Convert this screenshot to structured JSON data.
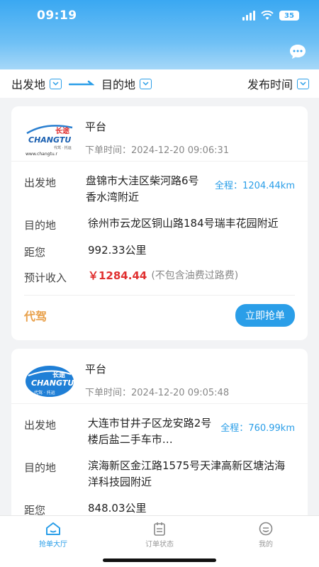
{
  "status": {
    "time": "09:19",
    "battery": "35"
  },
  "filters": {
    "origin": "出发地",
    "destination": "目的地",
    "publish_time": "发布时间"
  },
  "labels": {
    "origin": "出发地",
    "destination": "目的地",
    "distance": "距您",
    "income": "预计收入",
    "income_note": "(不包含油费过路费)",
    "total_prefix": "全程：",
    "order_time_prefix": "下单时间：",
    "grab": "立即抢单"
  },
  "logo": {
    "brand_en": "CHANGTU",
    "brand_cn": "长途",
    "slogan": "代驾 · 托运",
    "url": "www.changtu.r"
  },
  "orders": [
    {
      "platform": "平台",
      "order_time": "2024-12-20 09:06:31",
      "origin": "盘锦市大洼区柴河路6号香水湾附近",
      "total": "1204.44km",
      "destination": "徐州市云龙区铜山路184号瑞丰花园附近",
      "distance": "992.33公里",
      "income": "￥1284.44",
      "tag": "代驾"
    },
    {
      "platform": "平台",
      "order_time": "2024-12-20 09:05:48",
      "origin": "大连市甘井子区龙安路2号楼后盐二手车市…",
      "total": "760.99km",
      "destination": "滨海新区金江路1575号天津高新区塘沽海洋科技园附近",
      "distance": "848.03公里"
    }
  ],
  "tabs": [
    {
      "label": "抢单大厅",
      "icon": "home-icon",
      "active": true
    },
    {
      "label": "订单状态",
      "icon": "clipboard-icon",
      "active": false
    },
    {
      "label": "我的",
      "icon": "profile-icon",
      "active": false
    }
  ],
  "colors": {
    "accent": "#2a9ee8",
    "price": "#e03030",
    "tag": "#e8a04a"
  }
}
